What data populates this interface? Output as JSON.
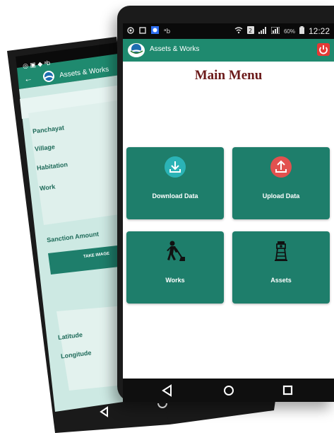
{
  "front_phone": {
    "status_bar": {
      "battery_percent": "60%",
      "time": "12:22"
    },
    "app_bar": {
      "title": "Assets & Works",
      "logo_icon": "globe-hand-logo-icon",
      "power_icon": "power-icon"
    },
    "main_menu": {
      "title": "Main Menu",
      "tiles": [
        {
          "label": "Download Data",
          "icon": "download-icon",
          "color": "#2bb3b6"
        },
        {
          "label": "Upload Data",
          "icon": "upload-icon",
          "color": "#e2514f"
        },
        {
          "label": "Works",
          "icon": "worker-shovel-icon"
        },
        {
          "label": "Assets",
          "icon": "tower-icon"
        }
      ]
    },
    "nav": [
      "back-icon",
      "home-icon",
      "recents-icon"
    ]
  },
  "back_phone": {
    "app_bar": {
      "title": "Assets & Works"
    },
    "form_labels": [
      "Panchayat",
      "Village",
      "Habitation",
      "Work",
      "Sanction Amount",
      "Latitude",
      "Longitude"
    ],
    "take_image_button": "TAKE IMAGE"
  },
  "colors": {
    "teal": "#1f8a6f",
    "tile_teal": "#1e7e6b",
    "title_maroon": "#6b1a1a",
    "power_red": "#e53935"
  }
}
